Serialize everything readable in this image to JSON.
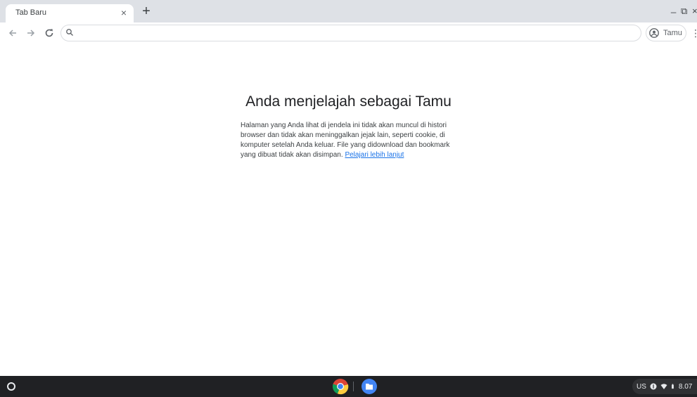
{
  "window": {
    "tab_title": "Tab Baru",
    "tab_close_glyph": "×",
    "new_tab_glyph": "+",
    "minimize_glyph": "_",
    "maximize_glyph": "⧉",
    "close_glyph": "×"
  },
  "toolbar": {
    "back_icon": "arrow-back-icon",
    "forward_icon": "arrow-forward-icon",
    "reload_icon": "reload-icon",
    "omnibox_value": "",
    "profile_label": "Tamu",
    "menu_glyph": "⋮"
  },
  "content": {
    "title": "Anda menjelajah sebagai Tamu",
    "description": "Halaman yang Anda lihat di jendela ini tidak akan muncul di histori browser dan tidak akan meninggalkan jejak lain, seperti cookie, di komputer setelah Anda keluar. File yang didownload dan bookmark yang dibuat tidak akan disimpan.",
    "link_text": "Pelajari lebih lanjut"
  },
  "shelf": {
    "ime_label": "US",
    "time": "8.07"
  },
  "colors": {
    "tabstrip": "#dee1e6",
    "link": "#1a73e8",
    "shelf": "#202124"
  }
}
